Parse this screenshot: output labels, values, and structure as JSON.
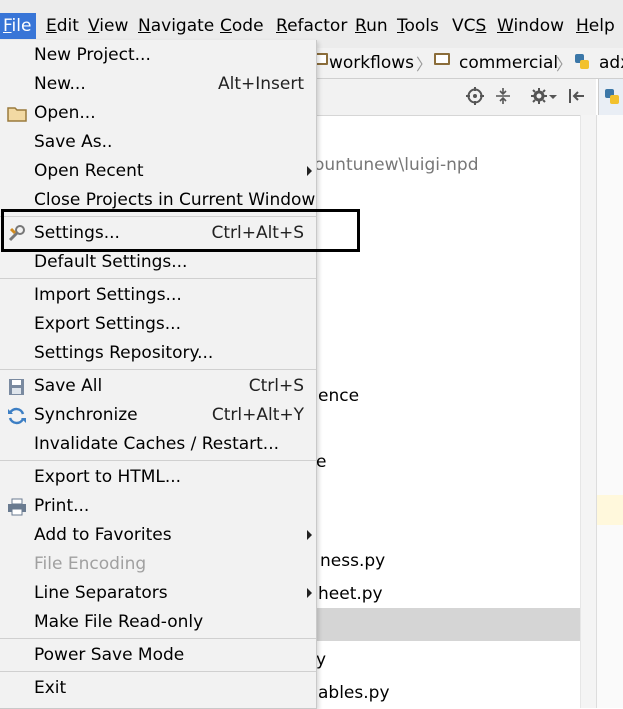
{
  "menubar": {
    "items": [
      {
        "label": "File",
        "mnemonic": "F",
        "rest": "ile"
      },
      {
        "label": "Edit",
        "mnemonic": "E",
        "rest": "dit"
      },
      {
        "label": "View",
        "mnemonic": "V",
        "rest": "iew"
      },
      {
        "label": "Navigate",
        "mnemonic": "N",
        "rest": "avigate"
      },
      {
        "label": "Code",
        "mnemonic": "C",
        "rest": "ode"
      },
      {
        "label": "Refactor",
        "mnemonic": "R",
        "rest": "efactor"
      },
      {
        "label": "Run",
        "mnemonic": "R",
        "rest": "un"
      },
      {
        "label": "Tools",
        "mnemonic": "T",
        "rest": "ools"
      },
      {
        "label": "VCS",
        "mnemonic": "S",
        "rest": "VC"
      },
      {
        "label": "Window",
        "mnemonic": "W",
        "rest": "indow"
      },
      {
        "label": "Help",
        "mnemonic": "H",
        "rest": "elp"
      }
    ]
  },
  "breadcrumb": {
    "items": [
      "workflows",
      "commercial",
      "adx"
    ]
  },
  "project_tree": {
    "path_fragment": "ountunew\\luigi-npd",
    "fragments": [
      "ence",
      "e",
      "ness.py",
      "heet.py",
      "y",
      "ables.py"
    ]
  },
  "file_menu": {
    "items": [
      {
        "label": "New Project...",
        "shortcut": "",
        "submenu": false,
        "icon": null
      },
      {
        "label": "New...",
        "shortcut": "Alt+Insert",
        "submenu": false,
        "icon": null
      },
      {
        "label": "Open...",
        "shortcut": "",
        "submenu": false,
        "icon": "folder-icon"
      },
      {
        "label": "Save As..",
        "shortcut": "",
        "submenu": false,
        "icon": null
      },
      {
        "label": "Open Recent",
        "shortcut": "",
        "submenu": true,
        "icon": null
      },
      {
        "label": "Close Projects in Current Window",
        "shortcut": "",
        "submenu": false,
        "icon": null
      },
      {
        "label": "Settings...",
        "shortcut": "Ctrl+Alt+S",
        "submenu": false,
        "icon": "settings-wrench-icon"
      },
      {
        "label": "Default Settings...",
        "shortcut": "",
        "submenu": false,
        "icon": null
      },
      {
        "label": "Import Settings...",
        "shortcut": "",
        "submenu": false,
        "icon": null
      },
      {
        "label": "Export Settings...",
        "shortcut": "",
        "submenu": false,
        "icon": null
      },
      {
        "label": "Settings Repository...",
        "shortcut": "",
        "submenu": false,
        "icon": null
      },
      {
        "label": "Save All",
        "shortcut": "Ctrl+S",
        "submenu": false,
        "icon": "save-icon"
      },
      {
        "label": "Synchronize",
        "shortcut": "Ctrl+Alt+Y",
        "submenu": false,
        "icon": "sync-icon"
      },
      {
        "label": "Invalidate Caches / Restart...",
        "shortcut": "",
        "submenu": false,
        "icon": null
      },
      {
        "label": "Export to HTML...",
        "shortcut": "",
        "submenu": false,
        "icon": null
      },
      {
        "label": "Print...",
        "shortcut": "",
        "submenu": false,
        "icon": "printer-icon"
      },
      {
        "label": "Add to Favorites",
        "shortcut": "",
        "submenu": true,
        "icon": null
      },
      {
        "label": "File Encoding",
        "shortcut": "",
        "submenu": false,
        "icon": null,
        "disabled": true
      },
      {
        "label": "Line Separators",
        "shortcut": "",
        "submenu": true,
        "icon": null
      },
      {
        "label": "Make File Read-only",
        "shortcut": "",
        "submenu": false,
        "icon": null
      },
      {
        "label": "Power Save Mode",
        "shortcut": "",
        "submenu": false,
        "icon": null
      },
      {
        "label": "Exit",
        "shortcut": "",
        "submenu": false,
        "icon": null
      }
    ]
  },
  "colors": {
    "menubar_active_bg": "#3875d7",
    "menu_bg": "#f2f2f2",
    "highlight_box": "#000000"
  }
}
